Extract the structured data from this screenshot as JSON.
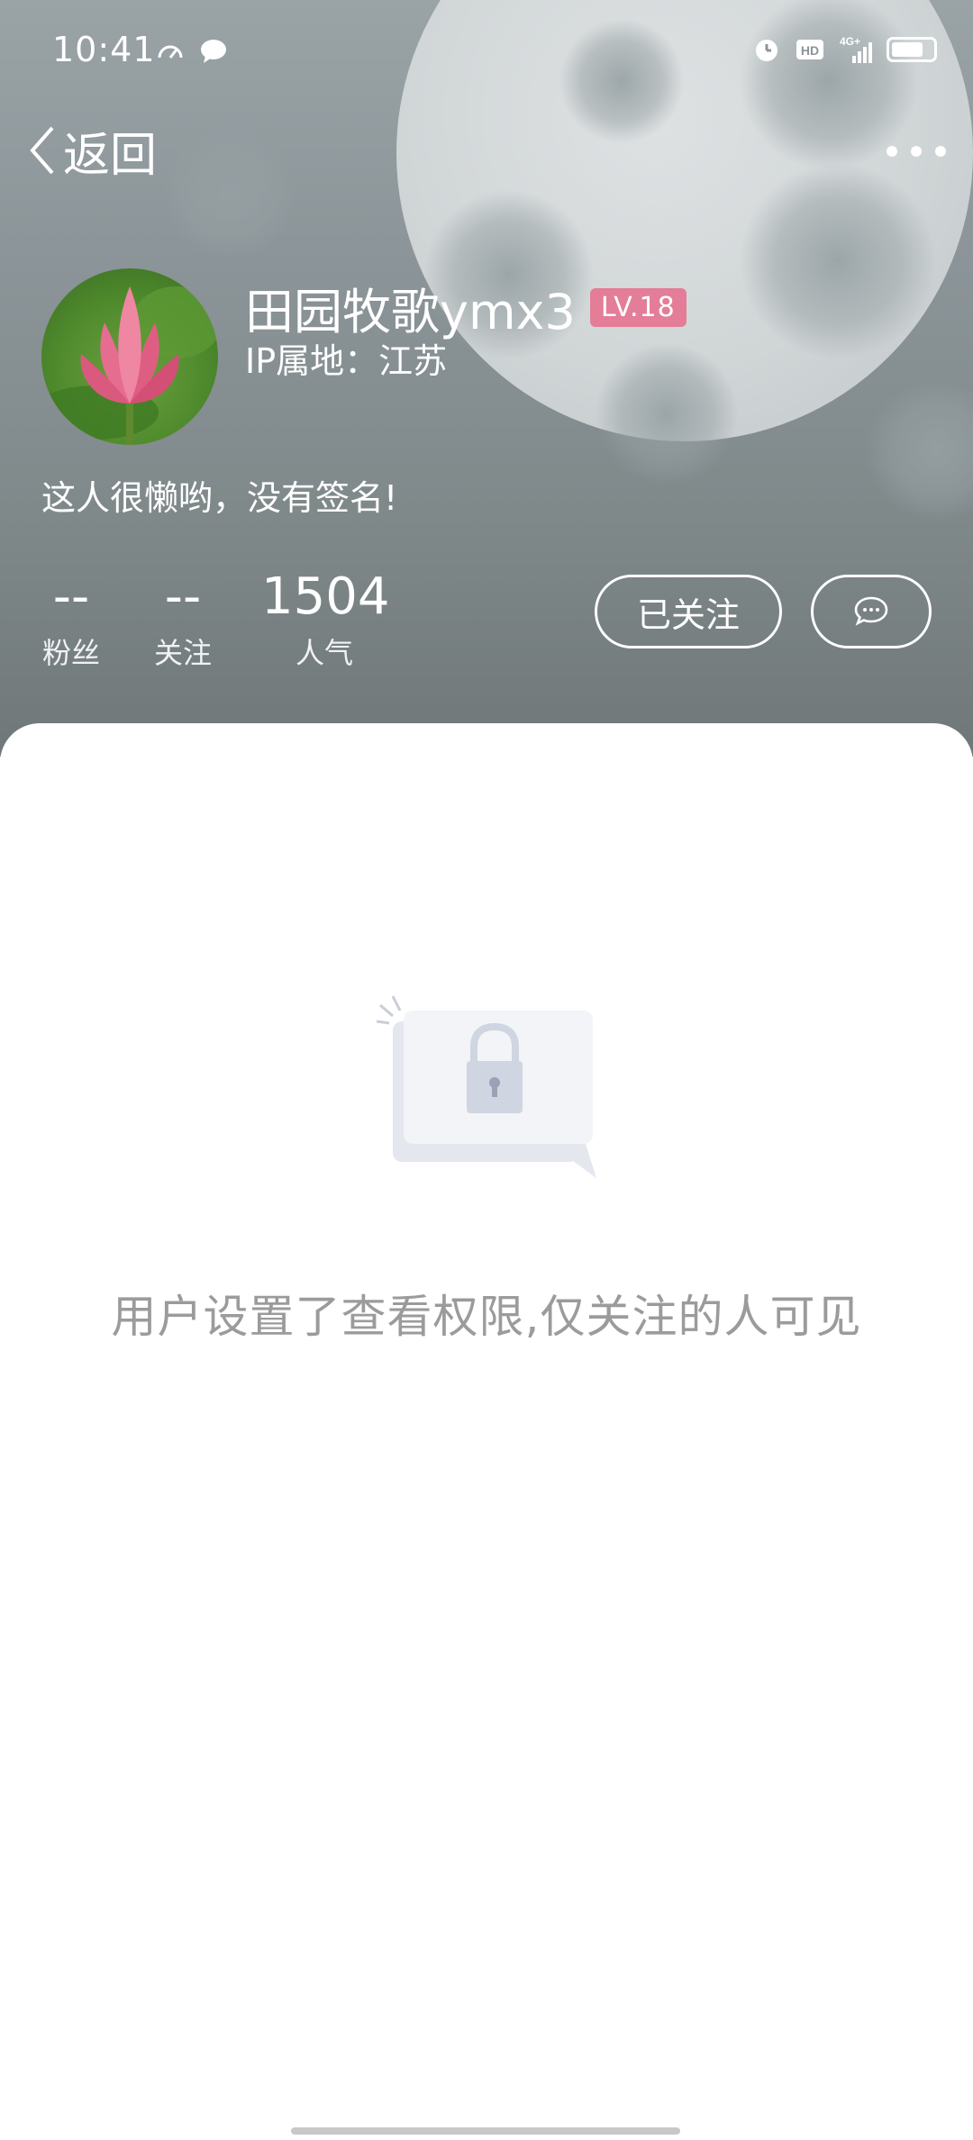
{
  "status_bar": {
    "time": "10:41",
    "icons_left": [
      "speedometer-icon",
      "chat-bubble-icon"
    ],
    "icons_right": [
      "alarm-icon",
      "hd-icon",
      "signal-4g-icon",
      "battery-icon"
    ]
  },
  "nav": {
    "back_label": "返回",
    "more_icon": "more-dots-icon"
  },
  "profile": {
    "username": "田园牧歌ymx3",
    "level": "LV.18",
    "ip_location": "IP属地：江苏",
    "signature": "这人很懒哟，没有签名!"
  },
  "stats": [
    {
      "value": "--",
      "label": "粉丝"
    },
    {
      "value": "--",
      "label": "关注"
    },
    {
      "value": "1504",
      "label": "人气"
    }
  ],
  "actions": {
    "follow_label": "已关注",
    "message_icon": "message-bubble-icon"
  },
  "content": {
    "permission_text": "用户设置了查看权限,仅关注的人可见"
  },
  "colors": {
    "level_badge": "#e47d98",
    "permission_text": "#9b9b9b",
    "header": "#8b9498"
  }
}
